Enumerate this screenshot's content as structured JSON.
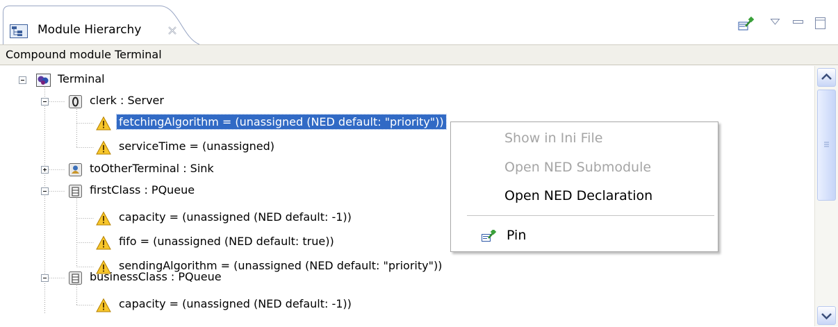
{
  "tab": {
    "title": "Module Hierarchy"
  },
  "content_title": "Compound module Terminal",
  "tree": {
    "rows": [
      {
        "label": "Terminal"
      },
      {
        "label": "clerk : Server"
      },
      {
        "label": "fetchingAlgorithm = (unassigned (NED default: \"priority\"))",
        "selected": true
      },
      {
        "label": "serviceTime = (unassigned)"
      },
      {
        "label": "toOtherTerminal : Sink"
      },
      {
        "label": "firstClass : PQueue"
      },
      {
        "label": "capacity = (unassigned (NED default: -1))"
      },
      {
        "label": "fifo = (unassigned (NED default: true))"
      },
      {
        "label": "sendingAlgorithm = (unassigned (NED default: \"priority\"))"
      },
      {
        "label": "businessClass : PQueue"
      },
      {
        "label": "capacity = (unassigned (NED default: -1))"
      }
    ]
  },
  "context_menu": {
    "items": [
      {
        "label": "Show in Ini File",
        "enabled": false
      },
      {
        "label": "Open NED Submodule",
        "enabled": false
      },
      {
        "label": "Open NED Declaration",
        "enabled": true
      },
      {
        "label": "Pin",
        "enabled": true
      }
    ]
  },
  "icons": {
    "tab": "module-hierarchy-icon",
    "close": "close-icon",
    "pin": "pin-icon",
    "view_menu": "view-menu-triangle-icon",
    "minimize": "minimize-icon",
    "maximize": "maximize-icon",
    "compound_module": "compound-module-icon",
    "server": "server-module-icon",
    "sink": "sink-module-icon",
    "queue": "queue-module-icon",
    "warning": "warning-icon"
  },
  "colors": {
    "selection": "#316ac5",
    "title_bar": "#f1f0ea",
    "disabled_text": "#a5a5a5",
    "warning": "#f7c62b"
  }
}
